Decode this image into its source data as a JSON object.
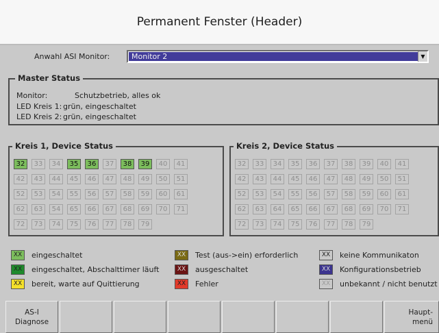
{
  "header": {
    "title": "Permanent Fenster (Header)"
  },
  "selector": {
    "label": "Anwahl ASI Monitor:",
    "value": "Monitor 2"
  },
  "master_status": {
    "title": "Master Status",
    "lines": [
      {
        "key": "Monitor:",
        "value": "Schutzbetrieb, alles ok"
      },
      {
        "key": "LED Kreis 1:",
        "value": "grün, eingeschaltet"
      },
      {
        "key": "LED Kreis 2:",
        "value": "grün, eingeschaltet"
      }
    ]
  },
  "kreis1": {
    "title": "Kreis 1, Device Status",
    "cells": [
      {
        "label": "32",
        "state": "on"
      },
      {
        "label": "33",
        "state": "off"
      },
      {
        "label": "34",
        "state": "off"
      },
      {
        "label": "35",
        "state": "on"
      },
      {
        "label": "36",
        "state": "on"
      },
      {
        "label": "37",
        "state": "off"
      },
      {
        "label": "38",
        "state": "on"
      },
      {
        "label": "39",
        "state": "on"
      },
      {
        "label": "40",
        "state": "off"
      },
      {
        "label": "41",
        "state": "off"
      },
      {
        "label": "42",
        "state": "off"
      },
      {
        "label": "43",
        "state": "off"
      },
      {
        "label": "44",
        "state": "off"
      },
      {
        "label": "45",
        "state": "off"
      },
      {
        "label": "46",
        "state": "off"
      },
      {
        "label": "47",
        "state": "off"
      },
      {
        "label": "48",
        "state": "off"
      },
      {
        "label": "49",
        "state": "off"
      },
      {
        "label": "50",
        "state": "off"
      },
      {
        "label": "51",
        "state": "off"
      },
      {
        "label": "52",
        "state": "off"
      },
      {
        "label": "53",
        "state": "off"
      },
      {
        "label": "54",
        "state": "off"
      },
      {
        "label": "55",
        "state": "off"
      },
      {
        "label": "56",
        "state": "off"
      },
      {
        "label": "57",
        "state": "off"
      },
      {
        "label": "58",
        "state": "off"
      },
      {
        "label": "59",
        "state": "off"
      },
      {
        "label": "60",
        "state": "off"
      },
      {
        "label": "61",
        "state": "off"
      },
      {
        "label": "62",
        "state": "off"
      },
      {
        "label": "63",
        "state": "off"
      },
      {
        "label": "54",
        "state": "off"
      },
      {
        "label": "65",
        "state": "off"
      },
      {
        "label": "66",
        "state": "off"
      },
      {
        "label": "67",
        "state": "off"
      },
      {
        "label": "68",
        "state": "off"
      },
      {
        "label": "69",
        "state": "off"
      },
      {
        "label": "70",
        "state": "off"
      },
      {
        "label": "71",
        "state": "off"
      },
      {
        "label": "72",
        "state": "off"
      },
      {
        "label": "73",
        "state": "off"
      },
      {
        "label": "74",
        "state": "off"
      },
      {
        "label": "75",
        "state": "off"
      },
      {
        "label": "76",
        "state": "off"
      },
      {
        "label": "77",
        "state": "off"
      },
      {
        "label": "78",
        "state": "off"
      },
      {
        "label": "79",
        "state": "off"
      }
    ]
  },
  "kreis2": {
    "title": "Kreis 2, Device Status",
    "cells": [
      {
        "label": "32",
        "state": "off"
      },
      {
        "label": "33",
        "state": "off"
      },
      {
        "label": "34",
        "state": "off"
      },
      {
        "label": "35",
        "state": "off"
      },
      {
        "label": "36",
        "state": "off"
      },
      {
        "label": "37",
        "state": "off"
      },
      {
        "label": "38",
        "state": "off"
      },
      {
        "label": "39",
        "state": "off"
      },
      {
        "label": "40",
        "state": "off"
      },
      {
        "label": "41",
        "state": "off"
      },
      {
        "label": "42",
        "state": "off"
      },
      {
        "label": "43",
        "state": "off"
      },
      {
        "label": "44",
        "state": "off"
      },
      {
        "label": "45",
        "state": "off"
      },
      {
        "label": "46",
        "state": "off"
      },
      {
        "label": "47",
        "state": "off"
      },
      {
        "label": "48",
        "state": "off"
      },
      {
        "label": "49",
        "state": "off"
      },
      {
        "label": "50",
        "state": "off"
      },
      {
        "label": "51",
        "state": "off"
      },
      {
        "label": "52",
        "state": "off"
      },
      {
        "label": "53",
        "state": "off"
      },
      {
        "label": "54",
        "state": "off"
      },
      {
        "label": "55",
        "state": "off"
      },
      {
        "label": "56",
        "state": "off"
      },
      {
        "label": "57",
        "state": "off"
      },
      {
        "label": "58",
        "state": "off"
      },
      {
        "label": "59",
        "state": "off"
      },
      {
        "label": "60",
        "state": "off"
      },
      {
        "label": "61",
        "state": "off"
      },
      {
        "label": "62",
        "state": "off"
      },
      {
        "label": "63",
        "state": "off"
      },
      {
        "label": "64",
        "state": "off"
      },
      {
        "label": "65",
        "state": "off"
      },
      {
        "label": "66",
        "state": "off"
      },
      {
        "label": "67",
        "state": "off"
      },
      {
        "label": "68",
        "state": "off"
      },
      {
        "label": "69",
        "state": "off"
      },
      {
        "label": "70",
        "state": "off"
      },
      {
        "label": "71",
        "state": "off"
      },
      {
        "label": "72",
        "state": "off"
      },
      {
        "label": "73",
        "state": "off"
      },
      {
        "label": "74",
        "state": "off"
      },
      {
        "label": "75",
        "state": "off"
      },
      {
        "label": "76",
        "state": "off"
      },
      {
        "label": "77",
        "state": "off"
      },
      {
        "label": "78",
        "state": "off"
      },
      {
        "label": "79",
        "state": "off"
      }
    ]
  },
  "legend": [
    {
      "swatch": "XX",
      "label": "eingeschaltet",
      "color": "#7cbd5d",
      "text_color": "#222222"
    },
    {
      "swatch": "XX",
      "label": "Test (aus->ein) erforderlich",
      "color": "#7a6a14",
      "text_color": "#d8d8d8"
    },
    {
      "swatch": "XX",
      "label": "keine Kommunikaton",
      "color": "#c9c9c9",
      "text_color": "#222222"
    },
    {
      "swatch": "XX",
      "label": "eingeschaltet, Abschalttimer läuft",
      "color": "#1f8a2c",
      "text_color": "#222222"
    },
    {
      "swatch": "XX",
      "label": "ausgeschaltet",
      "color": "#6b1414",
      "text_color": "#d8d8d8"
    },
    {
      "swatch": "XX",
      "label": "Konfigurationsbetrieb",
      "color": "#3c348f",
      "text_color": "#d8d8d8"
    },
    {
      "swatch": "XX",
      "label": "bereit, warte auf Quittierung",
      "color": "#f4e02a",
      "text_color": "#222222"
    },
    {
      "swatch": "XX",
      "label": "Fehler",
      "color": "#e23a2a",
      "text_color": "#222222"
    },
    {
      "swatch": "XX",
      "label": "unbekannt / nicht benutzt",
      "color": "#c9c9c9",
      "text_color": "#9a9a9a"
    }
  ],
  "buttons": [
    {
      "label": "AS-I\nDiagnose"
    },
    {
      "label": ""
    },
    {
      "label": ""
    },
    {
      "label": ""
    },
    {
      "label": ""
    },
    {
      "label": ""
    },
    {
      "label": ""
    },
    {
      "label": "Haupt-\nmenü"
    }
  ]
}
